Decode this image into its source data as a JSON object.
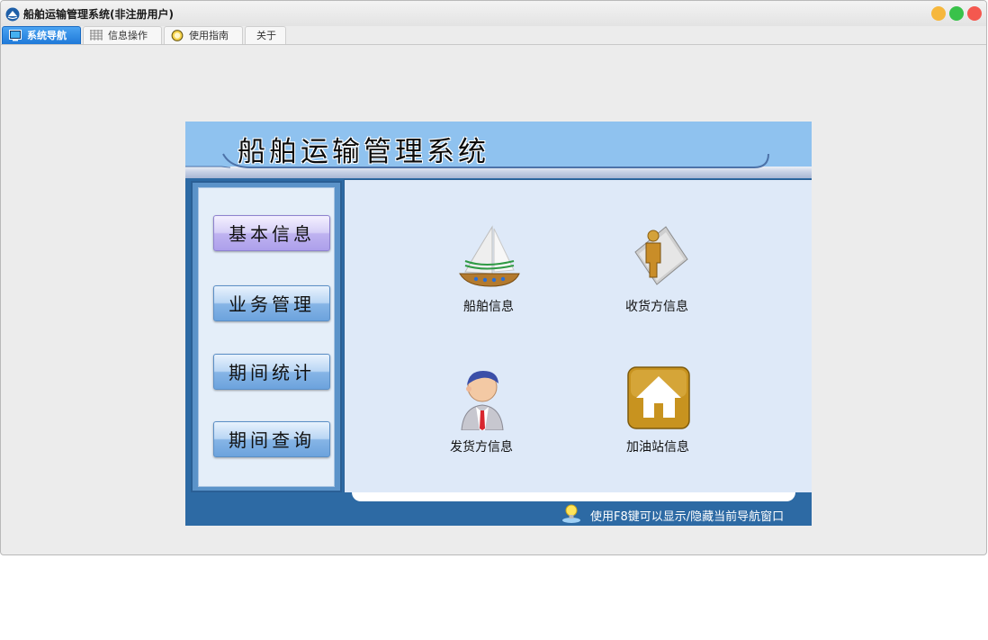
{
  "window": {
    "title": "船舶运输管理系统(非注册用户)",
    "controls": [
      "minimize",
      "maximize",
      "close"
    ]
  },
  "tabs": [
    {
      "label": "系统导航",
      "icon": "monitor-icon",
      "active": true
    },
    {
      "label": "信息操作",
      "icon": "grid-icon",
      "active": false
    },
    {
      "label": "使用指南",
      "icon": "compass-icon",
      "active": false
    },
    {
      "label": "关于",
      "icon": "",
      "active": false
    }
  ],
  "panel": {
    "title": "船舶运输管理系统",
    "nav": [
      {
        "label": "基本信息",
        "selected": true
      },
      {
        "label": "业务管理",
        "selected": false
      },
      {
        "label": "期间统计",
        "selected": false
      },
      {
        "label": "期间查询",
        "selected": false
      }
    ],
    "tiles": [
      {
        "label": "船舶信息",
        "icon": "ship-icon"
      },
      {
        "label": "收货方信息",
        "icon": "receiver-icon"
      },
      {
        "label": "发货方信息",
        "icon": "sender-icon"
      },
      {
        "label": "加油站信息",
        "icon": "gas-station-icon"
      }
    ],
    "hint": "使用F8键可以显示/隐藏当前导航窗口"
  },
  "colors": {
    "accent": "#1f79d8",
    "panel_blue": "#2d6aa4",
    "banner_blue": "#8fc2ef",
    "content_bg": "#dee9f8"
  }
}
